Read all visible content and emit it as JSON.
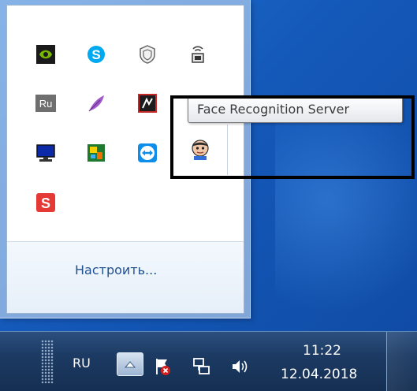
{
  "tooltip": {
    "text": "Face Recognition Server"
  },
  "tray_popup": {
    "customize_label": "Настроить...",
    "icons": [
      {
        "name": "nvidia-icon"
      },
      {
        "name": "skype-icon",
        "glyph": "S"
      },
      {
        "name": "shield-icon"
      },
      {
        "name": "network-printer-icon"
      },
      {
        "name": "ru-keyboard-icon",
        "glyph": "Ru"
      },
      {
        "name": "feather-icon"
      },
      {
        "name": "video-app-icon"
      },
      {
        "name": "computer-monitor-icon"
      },
      {
        "name": "map-app-icon"
      },
      {
        "name": "teamviewer-icon"
      },
      {
        "name": "face-recognition-server-icon"
      },
      {
        "name": "s-app-icon",
        "glyph": "S"
      }
    ]
  },
  "taskbar": {
    "language": "RU",
    "clock_time": "11:22",
    "clock_date": "12.04.2018",
    "icons": [
      "show-hidden-icons-icon",
      "action-center-flag-icon",
      "network-icon",
      "volume-icon"
    ]
  },
  "colors": {
    "desktop": "#1458b8",
    "taskbar": "#1c3a63",
    "link": "#1e4f8f",
    "highlight_border": "#000000"
  }
}
